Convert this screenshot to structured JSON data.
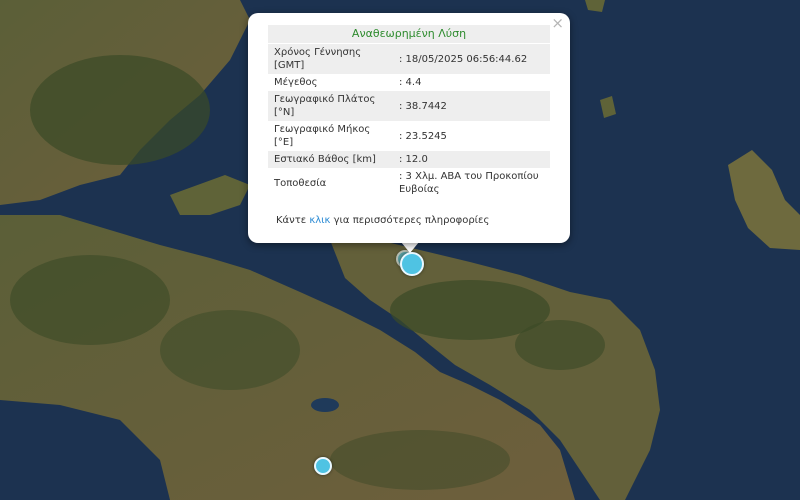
{
  "popup": {
    "title": "Αναθεωρημένη Λύση",
    "rows": [
      {
        "label": "Χρόνος Γέννησης [GMT]",
        "value": ": 18/05/2025 06:56:44.62"
      },
      {
        "label": "Μέγεθος",
        "value": ": 4.4"
      },
      {
        "label": "Γεωγραφικό Πλάτος [°N]",
        "value": ": 38.7442"
      },
      {
        "label": "Γεωγραφικό Μήκος [°E]",
        "value": ": 23.5245"
      },
      {
        "label": "Εστιακό Βάθος [km]",
        "value": ": 12.0"
      },
      {
        "label": "Τοποθεσία",
        "value": ": 3 Χλμ. ΑΒΑ του Προκοπίου Ευβοίας"
      }
    ],
    "footer": {
      "before": "Κάντε ",
      "link": "κλικ",
      "after": " για περισσότερες πληροφορίες"
    },
    "close": "×"
  },
  "map": {
    "sea_color": "#1d3350",
    "land_color": "#5a6238",
    "forest_color": "#3b4a26",
    "marker_color": "#4fc3e3"
  }
}
